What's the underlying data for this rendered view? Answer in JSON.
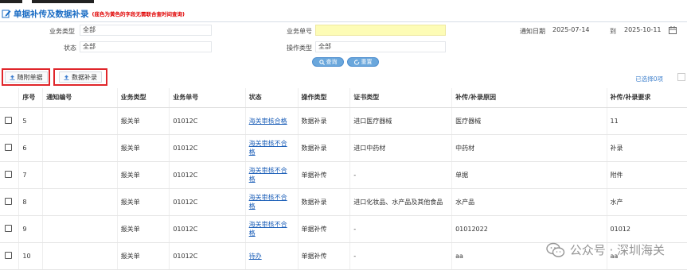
{
  "header": {
    "title": "单据补传及数据补录",
    "note": "(底色为黄色的字段无需联合查时间查询)"
  },
  "filters": {
    "biz_type_label": "业务类型",
    "biz_type_value": "全部",
    "biz_no_label": "业务单号",
    "biz_no_value": "",
    "notify_date_label": "通知日期",
    "date_from": "2025-07-14",
    "date_to_label": "到",
    "date_to": "2025-10-11",
    "status_label": "状态",
    "status_value": "全部",
    "op_type_label": "操作类型",
    "op_type_value": "全部"
  },
  "buttons": {
    "query": "查询",
    "reset": "重置",
    "attach": "随附单据",
    "data_entry": "数据补录"
  },
  "selected_info": "已选择0项",
  "table": {
    "headers": [
      "序号",
      "通知编号",
      "业务类型",
      "业务单号",
      "状态",
      "操作类型",
      "证书类型",
      "补传/补录原因",
      "补传/补录要求"
    ],
    "rows": [
      {
        "no": "5",
        "notify": "",
        "biz": "报关单",
        "bizno": "01012C",
        "status": "海关审核合格",
        "op": "数据补录",
        "cert": "进口医疗器械",
        "reason": "医疗器械",
        "req": "11"
      },
      {
        "no": "6",
        "notify": "",
        "biz": "报关单",
        "bizno": "01012C",
        "status": "海关审核不合格",
        "op": "数据补录",
        "cert": "进口中药材",
        "reason": "中药材",
        "req": "补录"
      },
      {
        "no": "7",
        "notify": "",
        "biz": "报关单",
        "bizno": "01012C",
        "status": "海关审核不合格",
        "op": "单据补传",
        "cert": "-",
        "reason": "单据",
        "req": "附件"
      },
      {
        "no": "8",
        "notify": "",
        "biz": "报关单",
        "bizno": "01012C",
        "status": "海关审核不合格",
        "op": "数据补录",
        "cert": "进口化妆品、水产品及其他食品",
        "reason": "水产品",
        "req": "水产"
      },
      {
        "no": "9",
        "notify": "",
        "biz": "报关单",
        "bizno": "01012C",
        "status": "海关审核不合格",
        "op": "单据补传",
        "cert": "-",
        "reason": "01012022",
        "req": "01012"
      },
      {
        "no": "10",
        "notify": "",
        "biz": "报关单",
        "bizno": "01012C",
        "status": "待办",
        "op": "单据补传",
        "cert": "-",
        "reason": "aa",
        "req": "aa"
      }
    ]
  },
  "watermark": {
    "text": "公众号 · 深圳海关"
  },
  "colors": {
    "accent": "#1a6cc4",
    "highlight_border": "#e0262b",
    "yellow_field": "#fdfcb6",
    "link": "#1c5fb8"
  }
}
